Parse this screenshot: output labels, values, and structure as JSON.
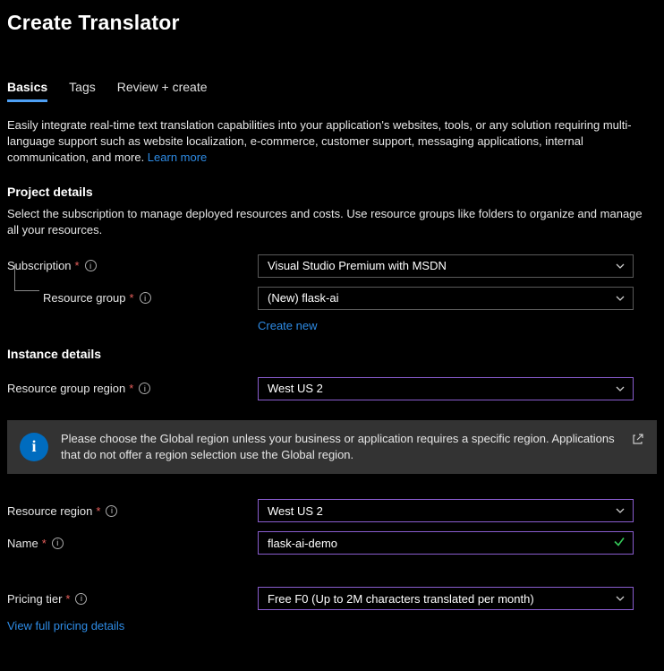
{
  "page_title": "Create Translator",
  "tabs": [
    {
      "label": "Basics",
      "active": true
    },
    {
      "label": "Tags",
      "active": false
    },
    {
      "label": "Review + create",
      "active": false
    }
  ],
  "intro": {
    "text": "Easily integrate real-time text translation capabilities into your application's websites, tools, or any solution requiring multi-language support such as website localization, e-commerce, customer support, messaging applications, internal communication, and more. ",
    "learn_more": "Learn more"
  },
  "sections": {
    "project": {
      "heading": "Project details",
      "desc": "Select the subscription to manage deployed resources and costs. Use resource groups like folders to organize and manage all your resources."
    },
    "instance": {
      "heading": "Instance details"
    }
  },
  "fields": {
    "subscription": {
      "label": "Subscription",
      "required": true,
      "value": "Visual Studio Premium with MSDN"
    },
    "resource_group": {
      "label": "Resource group",
      "required": true,
      "value": "(New) flask-ai",
      "create_new": "Create new"
    },
    "resource_group_region": {
      "label": "Resource group region",
      "required": true,
      "value": "West US 2"
    },
    "resource_region": {
      "label": "Resource region",
      "required": true,
      "value": "West US 2"
    },
    "name": {
      "label": "Name",
      "required": true,
      "value": "flask-ai-demo"
    },
    "pricing_tier": {
      "label": "Pricing tier",
      "required": true,
      "value": "Free F0 (Up to 2M characters translated per month)"
    }
  },
  "info_banner": {
    "text": "Please choose the Global region unless your business or application requires a specific region. Applications that do not offer a region selection use the Global region."
  },
  "links": {
    "pricing_details": "View full pricing details"
  }
}
